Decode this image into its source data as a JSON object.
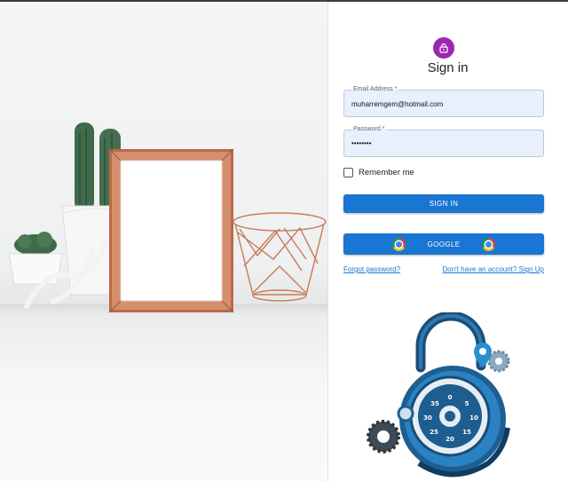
{
  "header": {
    "title": "Sign in",
    "icon": "lock-icon",
    "avatar_color": "#9c27b0"
  },
  "form": {
    "email": {
      "label": "Email Address *",
      "value": "muharremgem@hotmail.com"
    },
    "password": {
      "label": "Password *",
      "value": "••••••••"
    },
    "remember": {
      "label": "Remember me",
      "checked": false
    }
  },
  "buttons": {
    "signin_label": "SIGN IN",
    "google_label": "GOOGLE",
    "color": "#1976d2"
  },
  "links": {
    "forgot": "Forgot password?",
    "signup": "Don't have an account? Sign Up"
  },
  "illustration": {
    "dial_numbers": [
      "0",
      "5",
      "10",
      "15",
      "20",
      "25",
      "30",
      "35"
    ]
  }
}
